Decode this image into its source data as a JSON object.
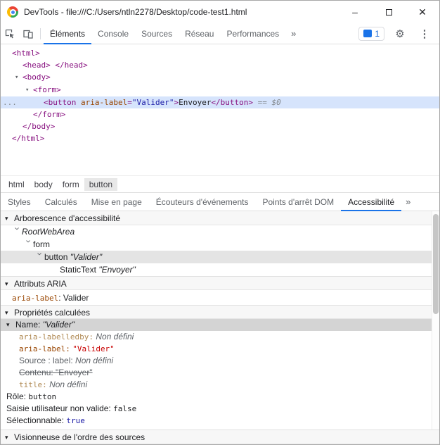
{
  "window": {
    "title": "DevTools - file:///C:/Users/ntln2278/Desktop/code-test1.html",
    "minimize": "–",
    "close": "✕"
  },
  "icons": {
    "gear": "⚙",
    "menu": "⋮",
    "more": "»",
    "header_caret": "▾"
  },
  "toolbar": {
    "badge": "1",
    "tabs": [
      {
        "t": "Éléments",
        "active": true
      },
      {
        "t": "Console"
      },
      {
        "t": "Sources"
      },
      {
        "t": "Réseau"
      },
      {
        "t": "Performances"
      }
    ]
  },
  "crumbs": [
    {
      "t": "html"
    },
    {
      "t": "body"
    },
    {
      "t": "form"
    },
    {
      "t": "button",
      "active": true
    }
  ],
  "subtabs": [
    {
      "t": "Styles"
    },
    {
      "t": "Calculés"
    },
    {
      "t": "Mise en page"
    },
    {
      "t": "Écouteurs d'événements"
    },
    {
      "t": "Points d'arrêt DOM"
    },
    {
      "t": "Accessibilité",
      "active": true
    }
  ],
  "dom": {
    "lines": [
      {
        "pad": 16,
        "name": "dom-node-html-open",
        "inter": true,
        "tokens": [
          {
            "t": "<html>",
            "c": "tag"
          }
        ]
      },
      {
        "pad": 31,
        "name": "dom-node-head",
        "inter": true,
        "tokens": [
          {
            "t": "<head>",
            "c": "tag"
          },
          {
            "t": " ",
            "c": "plain"
          },
          {
            "t": "</head>",
            "c": "tag"
          }
        ]
      },
      {
        "pad": 20,
        "name": "dom-node-body-open",
        "inter": true,
        "tokens": [
          {
            "t": "▾",
            "c": "caret",
            "n": "expand-caret-icon",
            "i": true
          },
          {
            "t": "<body>",
            "c": "tag"
          }
        ]
      },
      {
        "pad": 35,
        "name": "dom-node-form-open",
        "inter": true,
        "tokens": [
          {
            "t": "▾",
            "c": "caret",
            "n": "expand-caret-icon",
            "i": true
          },
          {
            "t": "<form>",
            "c": "tag"
          }
        ]
      },
      {
        "pad": 61,
        "cls": "sel-blue",
        "name": "dom-node-button-selected",
        "inter": true,
        "tokens": [
          {
            "t": "...",
            "c": "gutter",
            "n": "more-actions-icon",
            "i": true
          },
          {
            "t": "<button",
            "c": "tag"
          },
          {
            "t": " ",
            "c": "plain"
          },
          {
            "t": "aria-label",
            "c": "attr"
          },
          {
            "t": "=",
            "c": "tag"
          },
          {
            "t": "\"Valider\"",
            "c": "val"
          },
          {
            "t": ">",
            "c": "tag"
          },
          {
            "t": "Envoyer",
            "c": "plain"
          },
          {
            "t": "</button>",
            "c": "tag"
          },
          {
            "t": " == ",
            "c": "eq"
          },
          {
            "t": "$0",
            "c": "dollar"
          }
        ]
      },
      {
        "pad": 46,
        "name": "dom-node-form-close",
        "inter": true,
        "tokens": [
          {
            "t": "</form>",
            "c": "tag"
          }
        ]
      },
      {
        "pad": 31,
        "name": "dom-node-body-close",
        "inter": true,
        "tokens": [
          {
            "t": "</body>",
            "c": "tag"
          }
        ]
      },
      {
        "pad": 16,
        "name": "dom-node-html-close",
        "inter": true,
        "tokens": [
          {
            "t": "</html>",
            "c": "tag"
          }
        ]
      }
    ]
  },
  "a11y": {
    "tree_title": "Arborescence d'accessibilité",
    "aria_title": "Attributs ARIA",
    "computed_title": "Propriétés calculées",
    "sources_title": "Visionneuse de l'ordre des sources",
    "tree": [
      {
        "pad": 18,
        "name": "a11y-node-rootwebarea",
        "inter": true,
        "tokens": [
          {
            "t": "›",
            "c": "chev",
            "n": "expand-caret-icon",
            "i": true
          },
          {
            "t": "RootWebArea",
            "c": "rolei"
          }
        ]
      },
      {
        "pad": 34,
        "name": "a11y-node-form",
        "inter": true,
        "tokens": [
          {
            "t": "›",
            "c": "chev",
            "n": "expand-caret-icon",
            "i": true
          },
          {
            "t": "form",
            "c": "role"
          }
        ]
      },
      {
        "pad": 50,
        "cls": "sel-light",
        "name": "a11y-node-button-selected",
        "inter": true,
        "tokens": [
          {
            "t": "›",
            "c": "chev",
            "n": "expand-caret-icon",
            "i": true
          },
          {
            "t": "button ",
            "c": "role"
          },
          {
            "t": "\"Valider\"",
            "c": "stri"
          }
        ]
      },
      {
        "pad": 84,
        "name": "a11y-node-statictext",
        "inter": true,
        "tokens": [
          {
            "t": "StaticText ",
            "c": "role"
          },
          {
            "t": "\"Envoyer\"",
            "c": "stri"
          }
        ]
      }
    ],
    "aria_rows": [
      {
        "pad": 16,
        "name": "aria-attribute-row",
        "inter": false,
        "tokens": [
          {
            "t": "aria-label",
            "c": "attr mono"
          },
          {
            "t": ": ",
            "c": "plain2"
          },
          {
            "t": "Valider",
            "c": "plain2"
          }
        ]
      }
    ],
    "computed": [
      {
        "pad": 8,
        "cls": "sel-med",
        "name": "computed-name-row",
        "inter": true,
        "tokens": [
          {
            "t": "▾",
            "c": "hcaret",
            "n": "expand-caret-icon",
            "i": true
          },
          {
            "t": "Name: ",
            "c": "plain2"
          },
          {
            "t": "\"Valider\"",
            "c": "stri"
          }
        ]
      },
      {
        "pad": 26,
        "name": "computed-aria-labelledby-row",
        "inter": false,
        "tokens": [
          {
            "t": "aria-labelledby:",
            "c": "attrdim mono"
          },
          {
            "t": " ",
            "c": "plain2"
          },
          {
            "t": "Non défini",
            "c": "grayi"
          }
        ]
      },
      {
        "pad": 26,
        "name": "computed-aria-label-row",
        "inter": false,
        "tokens": [
          {
            "t": "aria-label:",
            "c": "attr mono"
          },
          {
            "t": " ",
            "c": "plain2"
          },
          {
            "t": "\"Valider\"",
            "c": "red mono"
          }
        ]
      },
      {
        "pad": 26,
        "name": "computed-source-label-row",
        "inter": false,
        "tokens": [
          {
            "t": "Source : label: ",
            "c": "gray"
          },
          {
            "t": "Non défini",
            "c": "grayi"
          }
        ]
      },
      {
        "pad": 26,
        "name": "computed-content-row",
        "inter": false,
        "tokens": [
          {
            "t": "Contenu: \"Envoyer\"",
            "c": "gray strike"
          }
        ]
      },
      {
        "pad": 26,
        "name": "computed-title-row",
        "inter": false,
        "tokens": [
          {
            "t": "title:",
            "c": "attrdim mono"
          },
          {
            "t": " ",
            "c": "plain2"
          },
          {
            "t": "Non défini",
            "c": "grayi"
          }
        ]
      },
      {
        "pad": 8,
        "name": "computed-role-row",
        "inter": false,
        "tokens": [
          {
            "t": "Rôle: ",
            "c": "plain2"
          },
          {
            "t": "button",
            "c": "dark mono"
          }
        ]
      },
      {
        "pad": 8,
        "name": "computed-invalid-row",
        "inter": false,
        "tokens": [
          {
            "t": "Saisie utilisateur non valide: ",
            "c": "plain2"
          },
          {
            "t": "false",
            "c": "dark mono"
          }
        ]
      },
      {
        "pad": 8,
        "name": "computed-focusable-row",
        "inter": false,
        "tokens": [
          {
            "t": "Sélectionnable: ",
            "c": "plain2"
          },
          {
            "t": "true",
            "c": "blue mono"
          }
        ]
      }
    ]
  }
}
